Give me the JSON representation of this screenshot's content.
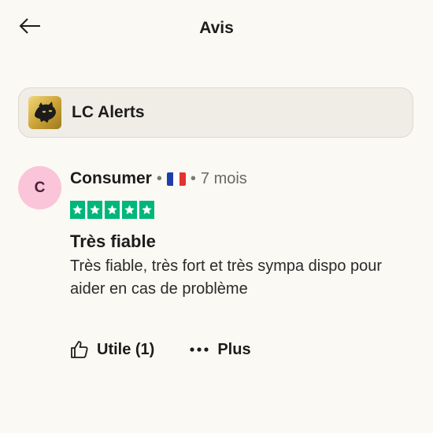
{
  "header": {
    "title": "Avis",
    "back_icon": "arrow-left-icon"
  },
  "company": {
    "name": "LC Alerts",
    "logo_icon": "panther-logo"
  },
  "review": {
    "avatar_initial": "C",
    "avatar_color": "#fac4d9",
    "reviewer_name": "Consumer",
    "separator": "•",
    "country_flag_icon": "france-flag-icon",
    "age": "7 mois",
    "rating": 5,
    "rating_max": 5,
    "star_color": "#00b67a",
    "title": "Très fiable",
    "body": "Très fiable, très fort et très sympa dispo pour aider en cas de problème"
  },
  "actions": {
    "useful_label": "Utile (1)",
    "useful_icon": "thumbs-up-icon",
    "more_label": "Plus",
    "more_icon": "ellipsis-icon"
  }
}
